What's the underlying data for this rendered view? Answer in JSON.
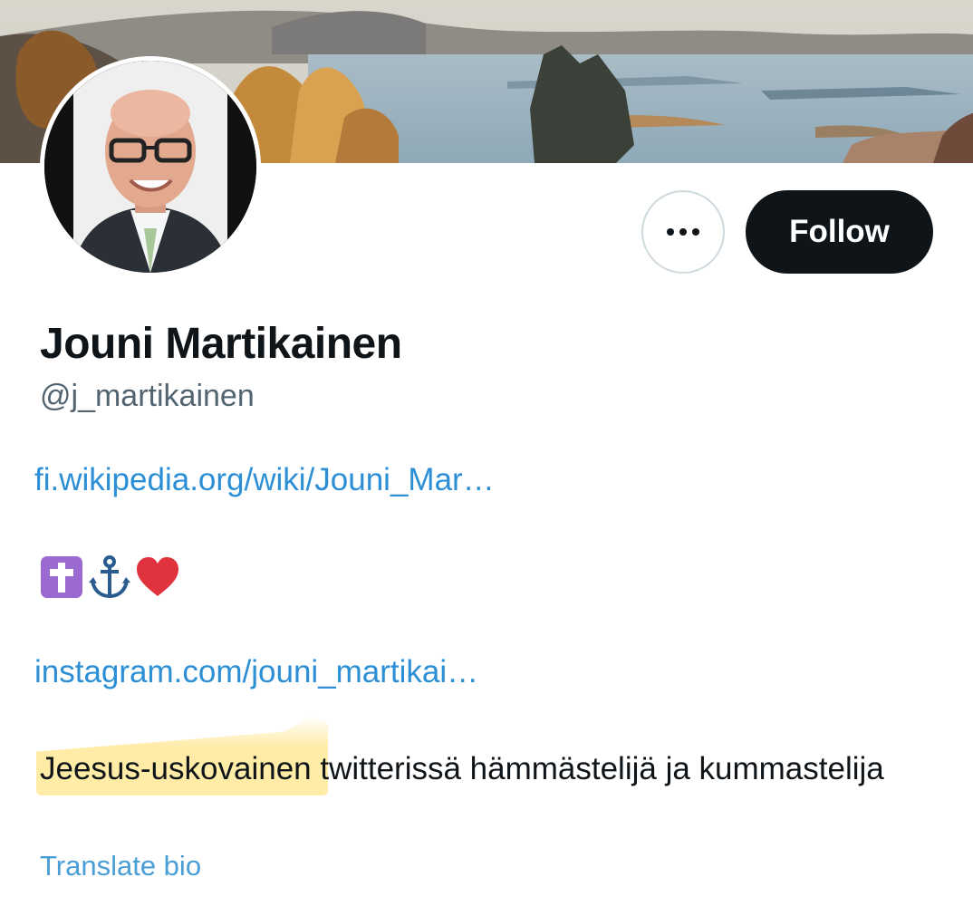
{
  "profile": {
    "display_name": "Jouni Martikainen",
    "handle": "@j_martikainen",
    "follow_label": "Follow",
    "links": {
      "wiki": "fi.wikipedia.org/wiki/Jouni_Mar…",
      "instagram": "instagram.com/jouni_martikai…"
    },
    "emojis": [
      "latin-cross-icon",
      "anchor-icon",
      "red-heart-icon"
    ],
    "bio": "Jeesus-uskovainen twitterissä hämmästelijä ja kummastelija",
    "translate_label": "Translate bio"
  },
  "colors": {
    "link": "#2c8fd6",
    "follow_bg": "#0f1419",
    "handle": "#536471",
    "highlight": "#ffe896"
  }
}
